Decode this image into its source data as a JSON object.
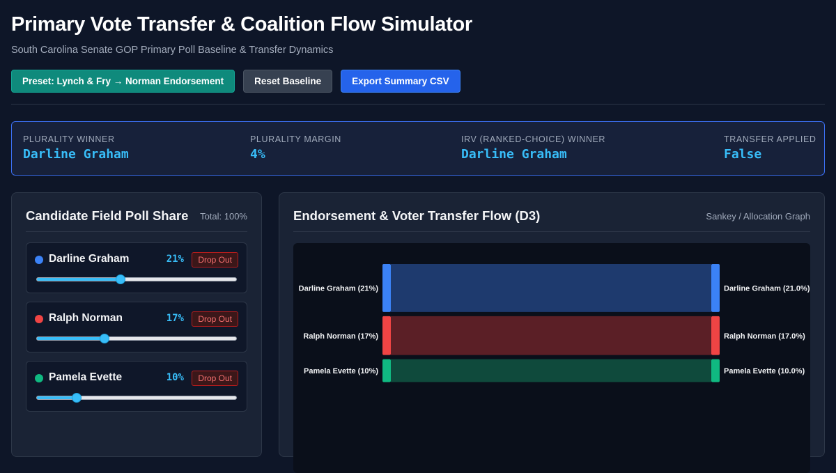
{
  "header": {
    "title": "Primary Vote Transfer & Coalition Flow Simulator",
    "subtitle": "South Carolina Senate GOP Primary Poll Baseline & Transfer Dynamics"
  },
  "toolbar": {
    "preset_label": "Preset: Lynch & Fry → Norman Endorsement",
    "reset_label": "Reset Baseline",
    "export_label": "Export Summary CSV"
  },
  "summary": {
    "plurality_winner_label": "PLURALITY WINNER",
    "plurality_winner_value": "Darline Graham",
    "plurality_margin_label": "PLURALITY MARGIN",
    "plurality_margin_value": "4%",
    "irv_winner_label": "IRV (RANKED-CHOICE) WINNER",
    "irv_winner_value": "Darline Graham",
    "transfer_applied_label": "TRANSFER APPLIED",
    "transfer_applied_value": "False"
  },
  "candidates_panel": {
    "title": "Candidate Field Poll Share",
    "total": "Total: 100%",
    "drop_label": "Drop Out",
    "candidates": [
      {
        "name": "Darline Graham",
        "share_text": "21%",
        "share": 21,
        "color": "#3b82f6"
      },
      {
        "name": "Ralph Norman",
        "share_text": "17%",
        "share": 17,
        "color": "#ef4444"
      },
      {
        "name": "Pamela Evette",
        "share_text": "10%",
        "share": 10,
        "color": "#10b981"
      }
    ]
  },
  "flow_panel": {
    "title": "Endorsement & Voter Transfer Flow (D3)",
    "meta": "Sankey / Allocation Graph",
    "flows": [
      {
        "source": "Darline Graham (21%)",
        "target": "Darline Graham (21.0%)",
        "value": 21,
        "color": "#3b82f6",
        "link_color": "#1e3a6e"
      },
      {
        "source": "Ralph Norman (17%)",
        "target": "Ralph Norman (17.0%)",
        "value": 17,
        "color": "#ef4444",
        "link_color": "#5b1f26"
      },
      {
        "source": "Pamela Evette (10%)",
        "target": "Pamela Evette (10.0%)",
        "value": 10,
        "color": "#10b981",
        "link_color": "#0f4a3c"
      }
    ]
  }
}
